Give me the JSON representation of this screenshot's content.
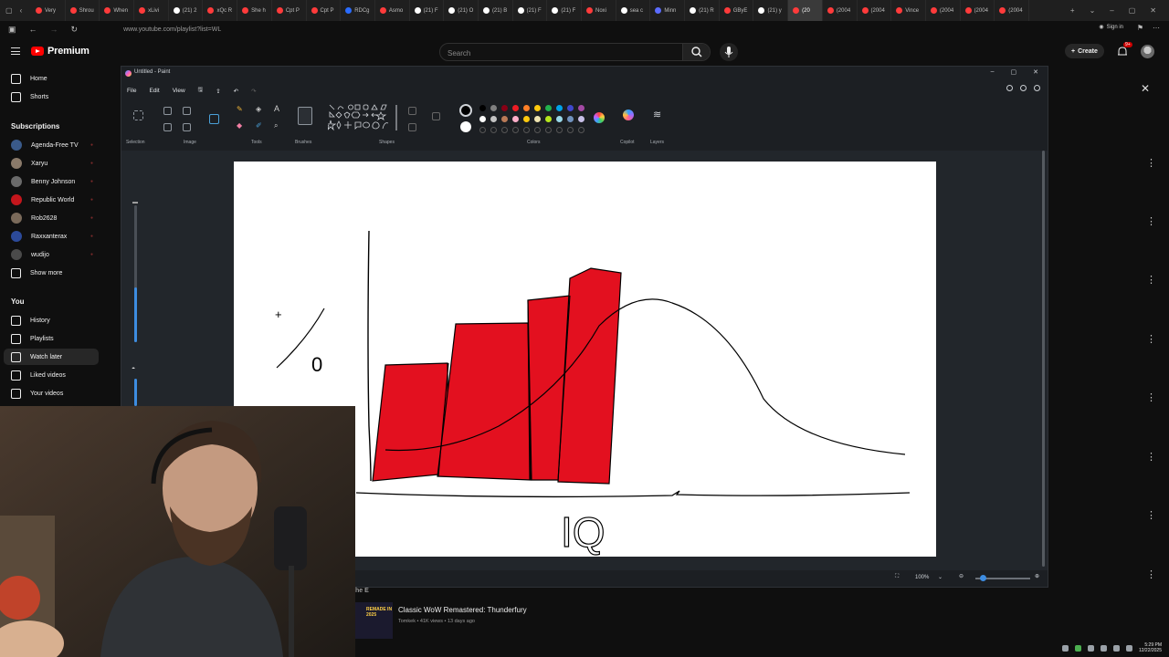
{
  "browser": {
    "tabs": [
      {
        "label": "Very",
        "color": "#ff3b3b"
      },
      {
        "label": "Shrou",
        "color": "#ff3b3b"
      },
      {
        "label": "When",
        "color": "#ff3b3b"
      },
      {
        "label": "xLivi",
        "color": "#ff3b3b"
      },
      {
        "label": "(21) 2",
        "color": "#ffffff"
      },
      {
        "label": "xQc R",
        "color": "#ff3b3b"
      },
      {
        "label": "She h",
        "color": "#ff3b3b"
      },
      {
        "label": "Cpt P",
        "color": "#ff3b3b"
      },
      {
        "label": "Cpt P",
        "color": "#ff3b3b"
      },
      {
        "label": "RDCg",
        "color": "#2a6cff"
      },
      {
        "label": "Asmo",
        "color": "#ff3b3b"
      },
      {
        "label": "(21) F",
        "color": "#ffffff"
      },
      {
        "label": "(21) O",
        "color": "#ffffff"
      },
      {
        "label": "(21) B",
        "color": "#ffffff"
      },
      {
        "label": "(21) F",
        "color": "#ffffff"
      },
      {
        "label": "(21) F",
        "color": "#ffffff"
      },
      {
        "label": "Noxi",
        "color": "#ff3b3b"
      },
      {
        "label": "sea c",
        "color": "#ffffff"
      },
      {
        "label": "Minn",
        "color": "#5b6cff"
      },
      {
        "label": "(21) R",
        "color": "#ffffff"
      },
      {
        "label": "GByE",
        "color": "#ff3b3b"
      },
      {
        "label": "(21) y",
        "color": "#ffffff"
      },
      {
        "label": "(20",
        "color": "#ff3b3b",
        "active": true
      },
      {
        "label": "(2004",
        "color": "#ff3b3b"
      },
      {
        "label": "(2004",
        "color": "#ff3b3b"
      },
      {
        "label": "Vince",
        "color": "#ff3b3b"
      },
      {
        "label": "(2004",
        "color": "#ff3b3b"
      },
      {
        "label": "(2004",
        "color": "#ff3b3b"
      },
      {
        "label": "(2004",
        "color": "#ff3b3b"
      }
    ],
    "url": "www.youtube.com/playlist?list=WL",
    "sign_in": "Sign in"
  },
  "youtube": {
    "logo_label": "Premium",
    "search_placeholder": "Search",
    "create_label": "Create",
    "notif_badge": "9+",
    "sidebar": {
      "top": [
        {
          "label": "Home",
          "icon": "home-icon"
        },
        {
          "label": "Shorts",
          "icon": "shorts-icon"
        }
      ],
      "subscriptions_heading": "Subscriptions",
      "subscriptions": [
        {
          "label": "Agenda-Free TV",
          "color": "#3a5a8a"
        },
        {
          "label": "Xaryu",
          "color": "#8a7a6a"
        },
        {
          "label": "Benny Johnson",
          "color": "#6a6a6a"
        },
        {
          "label": "Republic World",
          "color": "#c4161c"
        },
        {
          "label": "Rob2628",
          "color": "#7a6a5a"
        },
        {
          "label": "Raxxanterax",
          "color": "#2c4a9a"
        },
        {
          "label": "wudijo",
          "color": "#4a4a4a"
        }
      ],
      "show_more": "Show more",
      "you_heading": "You",
      "you": [
        {
          "label": "History",
          "icon": "history-icon"
        },
        {
          "label": "Playlists",
          "icon": "playlists-icon"
        },
        {
          "label": "Watch later",
          "icon": "watch-later-icon",
          "active": true
        },
        {
          "label": "Liked videos",
          "icon": "liked-icon"
        },
        {
          "label": "Your videos",
          "icon": "your-videos-icon"
        }
      ]
    },
    "video": {
      "partial_heading": "he E",
      "thumb_text": "REMADE IN 2025",
      "title": "Classic WoW Remastered: Thunderfury",
      "meta": "Tomkek • 41K views • 13 days ago"
    }
  },
  "paint": {
    "title": "Untitled - Paint",
    "menu": [
      "File",
      "Edit",
      "View"
    ],
    "groups": [
      "Selection",
      "Image",
      "Tools",
      "Brushes",
      "Shapes",
      "Colors",
      "Copilot",
      "Layers"
    ],
    "colors_row1": [
      "#000000",
      "#7f7f7f",
      "#880015",
      "#ed1c24",
      "#ff7f27",
      "#ffc90e",
      "#22b14c",
      "#00a2e8",
      "#3f48cc",
      "#a349a4"
    ],
    "colors_row2": [
      "#ffffff",
      "#c3c3c3",
      "#b97a57",
      "#ffaec9",
      "#ffc90e",
      "#efe4b0",
      "#b5e61d",
      "#99d9ea",
      "#7092be",
      "#c8bfe7"
    ],
    "zoom": "100%",
    "drawing": {
      "fill_color": "#e3101f",
      "axis_label": "IQ",
      "y_label_top": "+",
      "y_label_bottom": "0"
    }
  },
  "taskbar": {
    "time": "5:29 PM",
    "date": "12/22/2025"
  }
}
